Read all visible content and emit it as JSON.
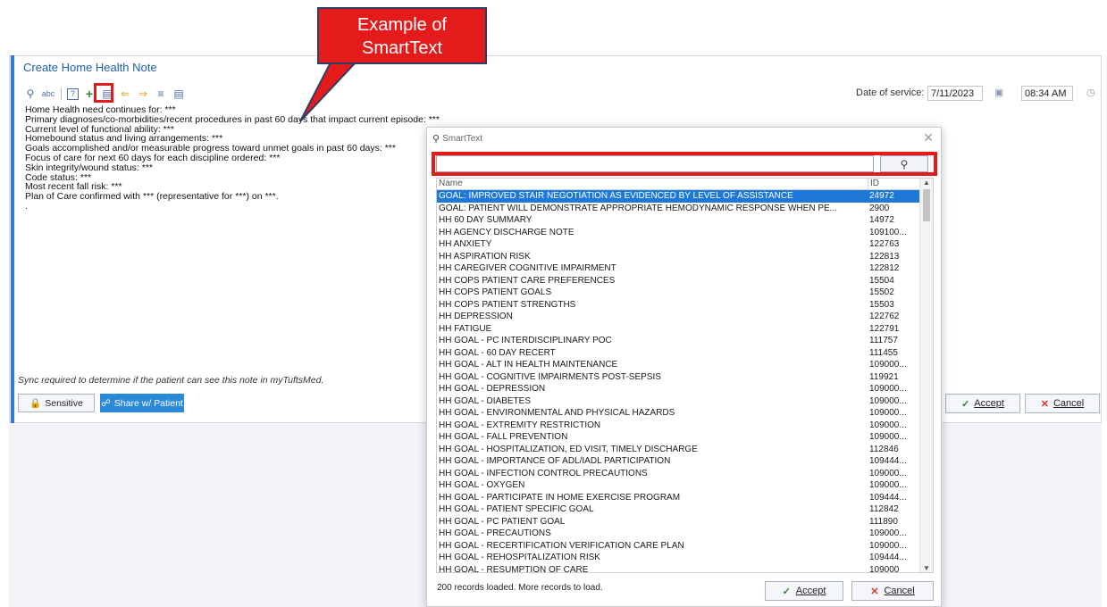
{
  "note": {
    "title": "Create Home Health  Note",
    "lines": [
      "Home Health need continues for: ***",
      "Primary diagnoses/co-morbidities/recent procedures in past 60 days that impact current episode: ***",
      "Current level of functional ability: ***",
      "Homebound status and living arrangements: ***",
      "Goals accomplished and/or measurable progress toward unmet goals in past 60 days: ***",
      "Focus of care for next 60 days for each discipline ordered: ***",
      "Skin integrity/wound status: ***",
      "Code status: ***",
      "Most recent fall risk: ***",
      "Plan of Care confirmed with *** (representative for ***) on ***.",
      "."
    ],
    "date_label": "Date of service:",
    "date_value": "7/11/2023",
    "time_value": "08:34 AM",
    "sync_text": "Sync required to determine if the patient can see this note in myTuftsMed.",
    "sensitive_label": "Sensitive",
    "share_label": "Share w/ Patient",
    "accept_label": "Accept",
    "cancel_label": "Cancel"
  },
  "callout": {
    "line1": "Example of",
    "line2": "SmartText",
    "color": "#e31b1b"
  },
  "dialog": {
    "title": "SmartText",
    "search_value": "",
    "columns": {
      "name": "Name",
      "id": "ID"
    },
    "rows": [
      {
        "name": "GOAL: IMPROVED STAIR NEGOTIATION AS EVIDENCED BY LEVEL OF ASSISTANCE",
        "id": "24972"
      },
      {
        "name": "GOAL: PATIENT WILL DEMONSTRATE APPROPRIATE HEMODYNAMIC RESPONSE WHEN PE...",
        "id": "2900"
      },
      {
        "name": "HH 60 DAY SUMMARY",
        "id": "14972"
      },
      {
        "name": "HH AGENCY DISCHARGE NOTE",
        "id": "109100..."
      },
      {
        "name": "HH ANXIETY",
        "id": "122763"
      },
      {
        "name": "HH ASPIRATION RISK",
        "id": "122813"
      },
      {
        "name": "HH CAREGIVER COGNITIVE IMPAIRMENT",
        "id": "122812"
      },
      {
        "name": "HH COPS PATIENT CARE PREFERENCES",
        "id": "15504"
      },
      {
        "name": "HH COPS PATIENT GOALS",
        "id": "15502"
      },
      {
        "name": "HH COPS PATIENT STRENGTHS",
        "id": "15503"
      },
      {
        "name": "HH DEPRESSION",
        "id": "122762"
      },
      {
        "name": "HH FATIGUE",
        "id": "122791"
      },
      {
        "name": "HH GOAL -  PC INTERDISCIPLINARY POC",
        "id": "111757"
      },
      {
        "name": "HH GOAL - 60 DAY RECERT",
        "id": "111455"
      },
      {
        "name": "HH GOAL - ALT IN HEALTH MAINTENANCE",
        "id": "109000..."
      },
      {
        "name": "HH GOAL - COGNITIVE IMPAIRMENTS POST-SEPSIS",
        "id": "119921"
      },
      {
        "name": "HH GOAL - DEPRESSION",
        "id": "109000..."
      },
      {
        "name": "HH GOAL - DIABETES",
        "id": "109000..."
      },
      {
        "name": "HH GOAL - ENVIRONMENTAL AND PHYSICAL HAZARDS",
        "id": "109000..."
      },
      {
        "name": "HH GOAL - EXTREMITY RESTRICTION",
        "id": "109000..."
      },
      {
        "name": "HH GOAL - FALL PREVENTION",
        "id": "109000..."
      },
      {
        "name": "HH GOAL - HOSPITALIZATION, ED VISIT, TIMELY DISCHARGE",
        "id": "112846"
      },
      {
        "name": "HH GOAL - IMPORTANCE OF ADL/IADL PARTICIPATION",
        "id": "109444..."
      },
      {
        "name": "HH GOAL - INFECTION CONTROL PRECAUTIONS",
        "id": "109000..."
      },
      {
        "name": "HH GOAL - OXYGEN",
        "id": "109000..."
      },
      {
        "name": "HH GOAL - PARTICIPATE IN HOME EXERCISE PROGRAM",
        "id": "109444..."
      },
      {
        "name": "HH GOAL - PATIENT SPECIFIC GOAL",
        "id": "112842"
      },
      {
        "name": "HH GOAL - PC PATIENT GOAL",
        "id": "111890"
      },
      {
        "name": "HH GOAL - PRECAUTIONS",
        "id": "109000..."
      },
      {
        "name": "HH GOAL - RECERTIFICATION VERIFICATION CARE PLAN",
        "id": "109000..."
      },
      {
        "name": "HH GOAL - REHOSPITALIZATION RISK",
        "id": "109444..."
      },
      {
        "name": "HH GOAL - RESUMPTION OF CARE",
        "id": "109000"
      }
    ],
    "selected_index": 0,
    "records_text": "200 records loaded. More records to load.",
    "accept_label": "Accept",
    "cancel_label": "Cancel"
  },
  "colors": {
    "accent_blue": "#2e7bcf",
    "selection": "#1e78d7",
    "highlight_red": "#e31b1b"
  }
}
